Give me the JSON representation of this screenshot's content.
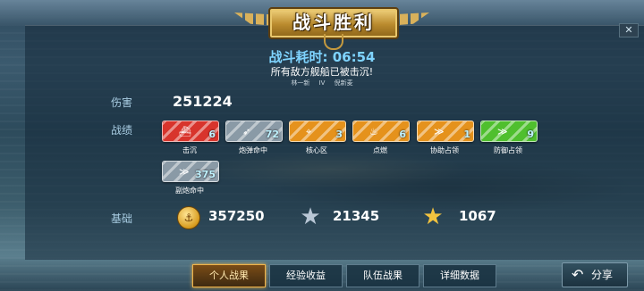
{
  "header": {
    "title": "战斗胜利",
    "time_label": "战斗耗时:",
    "time_value": "06:54",
    "message": "所有敌方舰船已被击沉!",
    "names": [
      "林一新",
      "IV",
      "倪新麦"
    ]
  },
  "stats": {
    "damage_label": "伤害",
    "damage_value": "251224",
    "achievements_label": "战绩",
    "base_label": "基础"
  },
  "medals": [
    {
      "label": "击沉",
      "count": "6",
      "color": "#d8342c",
      "icon": "ship-icon"
    },
    {
      "label": "炮弹命中",
      "count": "72",
      "color": "#8a9aa6",
      "icon": "shell-icon"
    },
    {
      "label": "核心区",
      "count": "3",
      "color": "#e5921c",
      "icon": "core-icon"
    },
    {
      "label": "点燃",
      "count": "6",
      "color": "#e5921c",
      "icon": "fire-icon"
    },
    {
      "label": "协助占领",
      "count": "1",
      "color": "#e5921c",
      "icon": "chevron-icon"
    },
    {
      "label": "防御占领",
      "count": "9",
      "color": "#4fbf2e",
      "icon": "chevron-icon"
    },
    {
      "label": "副炮命中",
      "count": "375",
      "color": "#8a9aa6",
      "icon": "secondary-gun-icon"
    }
  ],
  "base": {
    "coin_value": "357250",
    "silver_star_value": "21345",
    "gold_star_value": "1067"
  },
  "tabs": [
    "个人战果",
    "经验收益",
    "队伍战果",
    "详细数据"
  ],
  "active_tab": "个人战果",
  "share_label": "分享",
  "close_label": "✕"
}
